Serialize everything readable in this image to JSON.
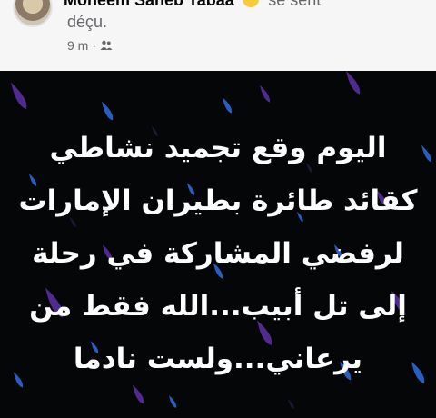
{
  "post": {
    "author": "Moneem Saheb Tabaa",
    "feeling_text": "se sent",
    "feeling_value": "déçu.",
    "timestamp": "9 m",
    "separator": "·",
    "audience_icon": "friends-icon",
    "feeling_icon": "disappointed-face-icon"
  },
  "image_text": {
    "lines": [
      "اليوم وقع تجميد نشاطي",
      "كقائد طائرة بطيران الإمارات",
      "لرفضي المشاركة في رحلة",
      "إلى تل أبيب...الله فقط من",
      "يرعاني...ولست نادما"
    ]
  },
  "colors": {
    "image_background": "#050608",
    "drop_purple": "#5b2fa0",
    "drop_blue": "#2b6ad6",
    "text": "#ffffff"
  }
}
